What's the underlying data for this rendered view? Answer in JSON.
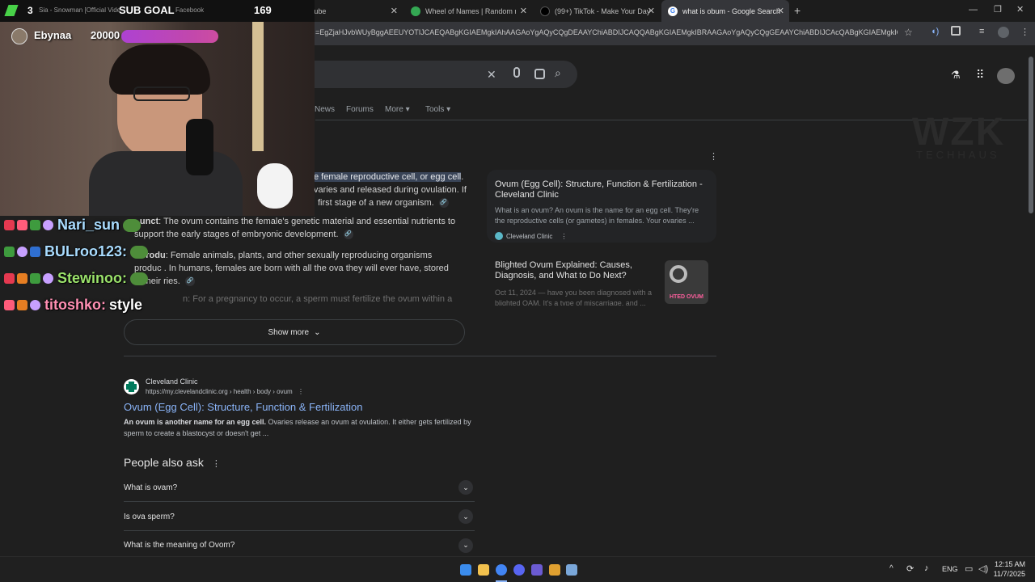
{
  "browser": {
    "tabs": [
      {
        "label": "Sia - Snowman [Official Video]",
        "color": "#ff0000"
      },
      {
        "label": "Facebook",
        "color": "#1877f2"
      },
      {
        "label": "YouTube",
        "color": "#ff0000"
      },
      {
        "label": "Wheel of Names | Random nam",
        "color": "#34a853"
      },
      {
        "label": "(99+) TikTok - Make Your Day",
        "color": "#222222"
      },
      {
        "label": "what is obum - Google Search",
        "color": "#4285f4"
      }
    ],
    "url": "=EgZjaHJvbWUyBggAEEUYOTIJCAEQABgKGIAEMgkIAhAAGAoYgAQyCQgDEAAYChiABDIJCAQQABgKGIAEMgkIBRAAGAoYgAQyCQgGEAAYChiABDIJCAcQABgKGIAEMgkICBAA..."
  },
  "search": {
    "nav": [
      "News",
      "Forums",
      "More",
      "Tools"
    ]
  },
  "snippet": {
    "line1_highlight": "e female reproductive cell, or egg cell",
    "line2": "varies and released during ovulation. If",
    "line3": "first stage of a new organism.",
    "b1_label": "unct",
    "b1_text": "The ovum contains the female's genetic material and essential nutrients to",
    "b1_cont": "support the early stages of embryonic development.",
    "b2_label": "Produ",
    "b2_text": ": Female animals, plants, and other sexually reproducing organisms",
    "b2_cont": "produc    . In humans, females are born with all the ova they will ever have, stored",
    "b2_cont2": "in their     ries.",
    "fade": "n: For a pregnancy to occur, a sperm must fertilize the ovum within a",
    "show_more": "Show more"
  },
  "side": {
    "card1_title": "Ovum (Egg Cell): Structure, Function & Fertilization - Cleveland Clinic",
    "card1_desc": "What is an ovum? An ovum is the name for an egg cell. They're the reproductive cells (or gametes) in females. Your ovaries ...",
    "card1_source": "Cleveland Clinic",
    "card2_title": "Blighted Ovum Explained: Causes, Diagnosis, and What to Do Next?",
    "card2_desc": "Oct 11, 2024 — have you been diagnosed with a blighted OAM. It's a type of miscarriage, and ...",
    "card2_thumb": "HTED OVUM"
  },
  "result": {
    "source": "Cleveland Clinic",
    "url": "https://my.clevelandclinic.org › health › body › ovum",
    "title": "Ovum (Egg Cell): Structure, Function & Fertilization",
    "desc_bold": "An ovum is another name for an egg cell.",
    "desc_rest": " Ovaries release an ovum at ovulation. It either gets fertilized by sperm to create a blastocyst or doesn't get ..."
  },
  "paa": {
    "heading": "People also ask",
    "items": [
      "What is ovam?",
      "Is ova sperm?",
      "What is the meaning of Ovom?"
    ]
  },
  "overlay": {
    "streamer": "Ebynaa",
    "sub_goal": "SUB GOAL",
    "sub_count": "169",
    "sub_number": "3",
    "bits": "20000",
    "watermark": "WZK",
    "watermark_sub": "TECHHAUS"
  },
  "chat": [
    {
      "user": "Nari_sun",
      "message": "",
      "color": "#a9dcff"
    },
    {
      "user": "BULroo123:",
      "message": "",
      "color": "#a9dcff"
    },
    {
      "user": "Stewinoo:",
      "message": "",
      "color": "#9be36b"
    },
    {
      "user": "titoshko:",
      "message": "style",
      "color": "#ff8fb3"
    }
  ],
  "taskbar": {
    "lang": "ENG",
    "time": "12:15 AM",
    "date": "11/7/2025"
  }
}
